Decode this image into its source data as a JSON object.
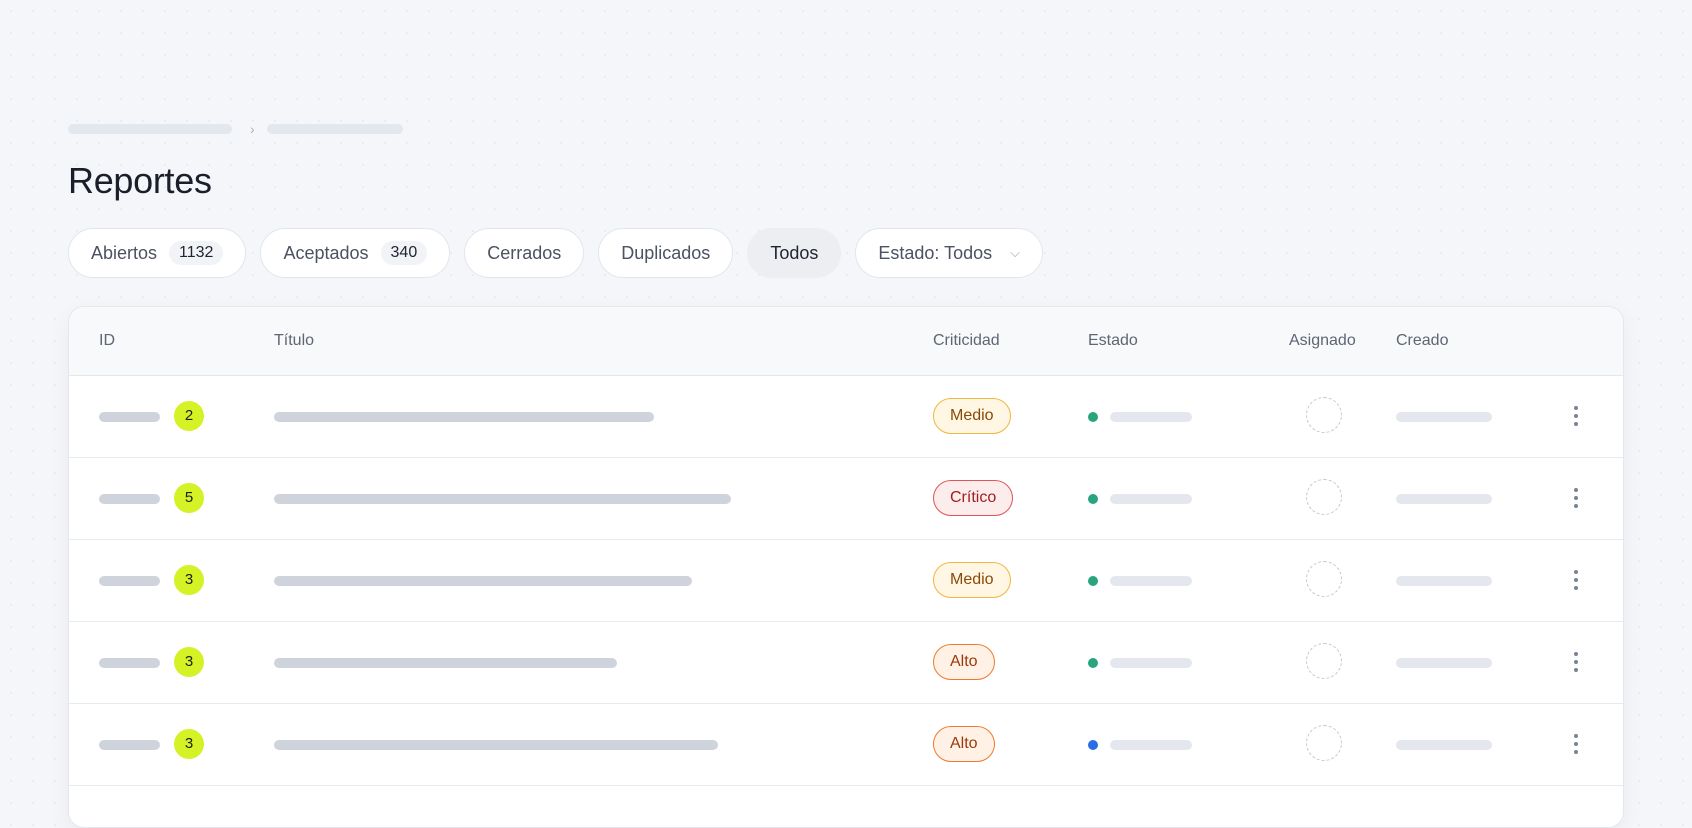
{
  "page": {
    "title": "Reportes"
  },
  "filters": [
    {
      "label": "Abiertos",
      "count": "1132",
      "active": false
    },
    {
      "label": "Aceptados",
      "count": "340",
      "active": false
    },
    {
      "label": "Cerrados",
      "active": false
    },
    {
      "label": "Duplicados",
      "active": false
    },
    {
      "label": "Todos",
      "active": true
    }
  ],
  "status_select": {
    "label": "Estado: Todos",
    "icon": "chevron-down-icon"
  },
  "table": {
    "columns": {
      "id": "ID",
      "title": "Título",
      "criticality": "Criticidad",
      "status": "Estado",
      "assigned": "Asignado",
      "created": "Creado"
    },
    "rows": [
      {
        "count": "2",
        "criticality": "Medio",
        "level": "medio",
        "status_color": "#2aa47e"
      },
      {
        "count": "5",
        "criticality": "Crítico",
        "level": "critico",
        "status_color": "#2aa47e"
      },
      {
        "count": "3",
        "criticality": "Medio",
        "level": "medio",
        "status_color": "#2aa47e"
      },
      {
        "count": "3",
        "criticality": "Alto",
        "level": "alto",
        "status_color": "#2aa47e"
      },
      {
        "count": "3",
        "criticality": "Alto",
        "level": "alto",
        "status_color": "#2b6de3"
      }
    ]
  },
  "colors": {
    "id_badge": "#d4f226",
    "medio": "#f0b63d",
    "critico": "#e05555",
    "alto": "#ee7a2e"
  }
}
